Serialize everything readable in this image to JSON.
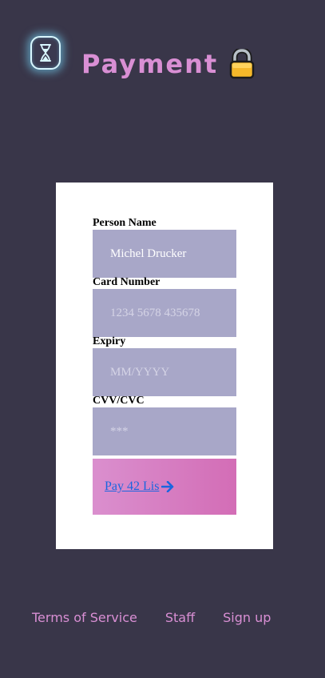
{
  "header": {
    "title": "Payment",
    "logo_icon": "hourglass-icon",
    "title_icon": "lock-icon"
  },
  "form": {
    "fields": [
      {
        "label": "Person Name",
        "value": "Michel Drucker",
        "placeholder": ""
      },
      {
        "label": "Card Number",
        "value": "",
        "placeholder": "1234 5678 435678"
      },
      {
        "label": "Expiry",
        "value": "",
        "placeholder": "MM/YYYY"
      },
      {
        "label": "CVV/CVC",
        "value": "",
        "placeholder": "***"
      }
    ],
    "submit_label": "Pay 42 Lis",
    "submit_icon": "arrow-right-icon"
  },
  "footer": {
    "links": [
      "Terms of Service",
      "Staff",
      "Sign up"
    ]
  },
  "colors": {
    "background": "#393649",
    "accent": "#d98fd4",
    "input_bg": "#a8a7c8",
    "link": "#1a66e0"
  }
}
